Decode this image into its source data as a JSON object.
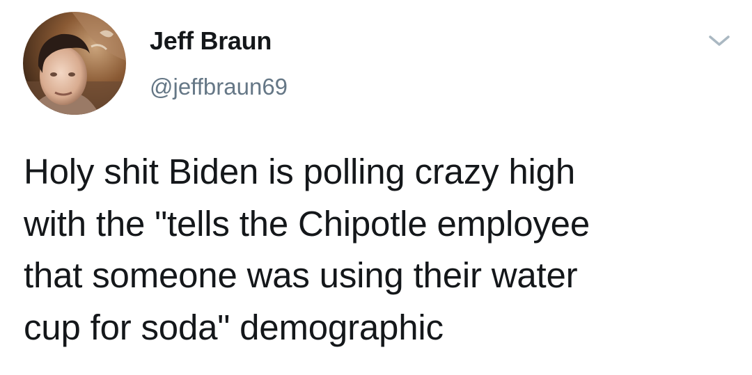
{
  "author": {
    "display_name": "Jeff Braun",
    "handle": "@jeffbraun69",
    "avatar_icon": "profile-photo"
  },
  "menu": {
    "icon": "chevron-down-icon",
    "color": "#aab8c2"
  },
  "tweet": {
    "lines": [
      "Holy shit Biden is polling crazy high",
      "with the \"tells the Chipotle employee",
      "that someone was using their water",
      "cup for soda\" demographic"
    ]
  },
  "colors": {
    "text": "#14171a",
    "secondary": "#657786",
    "background": "#ffffff"
  }
}
